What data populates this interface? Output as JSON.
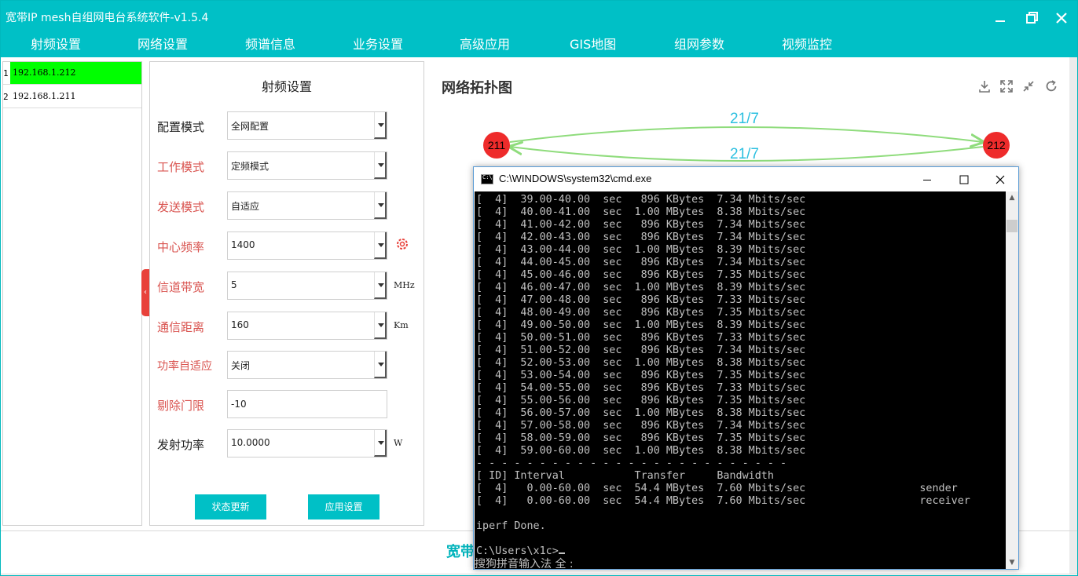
{
  "app": {
    "title": "宽带IP mesh自组网电台系统软件-v1.5.4",
    "nav": [
      "射频设置",
      "网络设置",
      "频谱信息",
      "业务设置",
      "高级应用",
      "GIS地图",
      "组网参数",
      "视频监控"
    ],
    "footer_text": "宽带"
  },
  "devices": [
    {
      "index": "1",
      "ip": "192.168.1.212",
      "selected": true
    },
    {
      "index": "2",
      "ip": "192.168.1.211",
      "selected": false
    }
  ],
  "rf": {
    "title": "射频设置",
    "fields": [
      {
        "label": "配置模式",
        "value": "全网配置",
        "unit": ""
      },
      {
        "label": "工作模式",
        "value": "定频模式",
        "unit": ""
      },
      {
        "label": "发送模式",
        "value": "自适应",
        "unit": ""
      },
      {
        "label": "中心频率",
        "value": "1400",
        "unit": ""
      },
      {
        "label": "信道带宽",
        "value": "5",
        "unit": "MHz"
      },
      {
        "label": "通信距离",
        "value": "160",
        "unit": "Km"
      },
      {
        "label": "功率自适应",
        "value": "关闭",
        "unit": ""
      },
      {
        "label": "剔除门限",
        "value": "-10",
        "unit": ""
      },
      {
        "label": "发射功率",
        "value": "10.0000",
        "unit": "W"
      }
    ],
    "buttons": {
      "refresh": "状态更新",
      "apply": "应用设置"
    }
  },
  "topology": {
    "title": "网络拓扑图",
    "nodes": [
      {
        "label": "211"
      },
      {
        "label": "212"
      }
    ],
    "links": [
      {
        "label": "21/7"
      },
      {
        "label": "21/7"
      }
    ],
    "colors": {
      "node": "#ee2b2b",
      "link": "#8fdc7c",
      "label": "#2bbfe0"
    }
  },
  "cmd": {
    "title": "C:\\WINDOWS\\system32\\cmd.exe",
    "lines": [
      "[  4]  39.00-40.00  sec   896 KBytes  7.34 Mbits/sec",
      "[  4]  40.00-41.00  sec  1.00 MBytes  8.38 Mbits/sec",
      "[  4]  41.00-42.00  sec   896 KBytes  7.34 Mbits/sec",
      "[  4]  42.00-43.00  sec   896 KBytes  7.34 Mbits/sec",
      "[  4]  43.00-44.00  sec  1.00 MBytes  8.39 Mbits/sec",
      "[  4]  44.00-45.00  sec   896 KBytes  7.34 Mbits/sec",
      "[  4]  45.00-46.00  sec   896 KBytes  7.35 Mbits/sec",
      "[  4]  46.00-47.00  sec  1.00 MBytes  8.39 Mbits/sec",
      "[  4]  47.00-48.00  sec   896 KBytes  7.33 Mbits/sec",
      "[  4]  48.00-49.00  sec   896 KBytes  7.35 Mbits/sec",
      "[  4]  49.00-50.00  sec  1.00 MBytes  8.39 Mbits/sec",
      "[  4]  50.00-51.00  sec   896 KBytes  7.33 Mbits/sec",
      "[  4]  51.00-52.00  sec   896 KBytes  7.34 Mbits/sec",
      "[  4]  52.00-53.00  sec  1.00 MBytes  8.38 Mbits/sec",
      "[  4]  53.00-54.00  sec   896 KBytes  7.35 Mbits/sec",
      "[  4]  54.00-55.00  sec   896 KBytes  7.33 Mbits/sec",
      "[  4]  55.00-56.00  sec   896 KBytes  7.35 Mbits/sec",
      "[  4]  56.00-57.00  sec  1.00 MBytes  8.38 Mbits/sec",
      "[  4]  57.00-58.00  sec   896 KBytes  7.34 Mbits/sec",
      "[  4]  58.00-59.00  sec   896 KBytes  7.35 Mbits/sec",
      "[  4]  59.00-60.00  sec  1.00 MBytes  8.38 Mbits/sec",
      "- - - - - - - - - - - - - - - - - - - - - - - - -",
      "[ ID] Interval           Transfer     Bandwidth",
      "[  4]   0.00-60.00  sec  54.4 MBytes  7.60 Mbits/sec                  sender",
      "[  4]   0.00-60.00  sec  54.4 MBytes  7.60 Mbits/sec                  receiver",
      "",
      "iperf Done.",
      "",
      "C:\\Users\\x1c>"
    ],
    "ime_text": "搜狗拼音输入法 全 :"
  }
}
